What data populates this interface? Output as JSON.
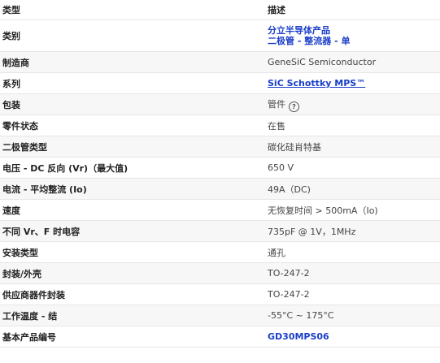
{
  "header": {
    "col_type": "类型",
    "col_desc": "描述"
  },
  "rows": [
    {
      "attr": "类别",
      "cat1": "分立半导体产品",
      "cat2": "二极管 - 整流器 - 单"
    },
    {
      "attr": "制造商",
      "value": "GeneSiC Semiconductor"
    },
    {
      "attr": "系列",
      "value": "SiC Schottky MPS™"
    },
    {
      "attr": "包装",
      "value": "管件",
      "help_icon": "question-circle-icon"
    },
    {
      "attr": "零件状态",
      "value": "在售"
    },
    {
      "attr": "二极管类型",
      "value": "碳化硅肖特基"
    },
    {
      "attr": "电压 - DC 反向 (Vr)（最大值)",
      "value": "650 V"
    },
    {
      "attr": "电流 - 平均整流 (Io)",
      "value": "49A（DC)"
    },
    {
      "attr": "速度",
      "value": "无恢复时间 > 500mA（Io)"
    },
    {
      "attr": "不同 Vr、F 时电容",
      "value": "735pF @ 1V，1MHz"
    },
    {
      "attr": "安装类型",
      "value": "通孔"
    },
    {
      "attr": "封装/外壳",
      "value": "TO-247-2"
    },
    {
      "attr": "供应商器件封装",
      "value": "TO-247-2"
    },
    {
      "attr": "工作温度 - 结",
      "value": "-55°C ~ 175°C"
    },
    {
      "attr": "基本产品编号",
      "value": "GD30MPS06"
    }
  ],
  "colors": {
    "link": "#1a3ec9",
    "row_alt": "#f7f7f7",
    "border": "#e6e6e6"
  }
}
